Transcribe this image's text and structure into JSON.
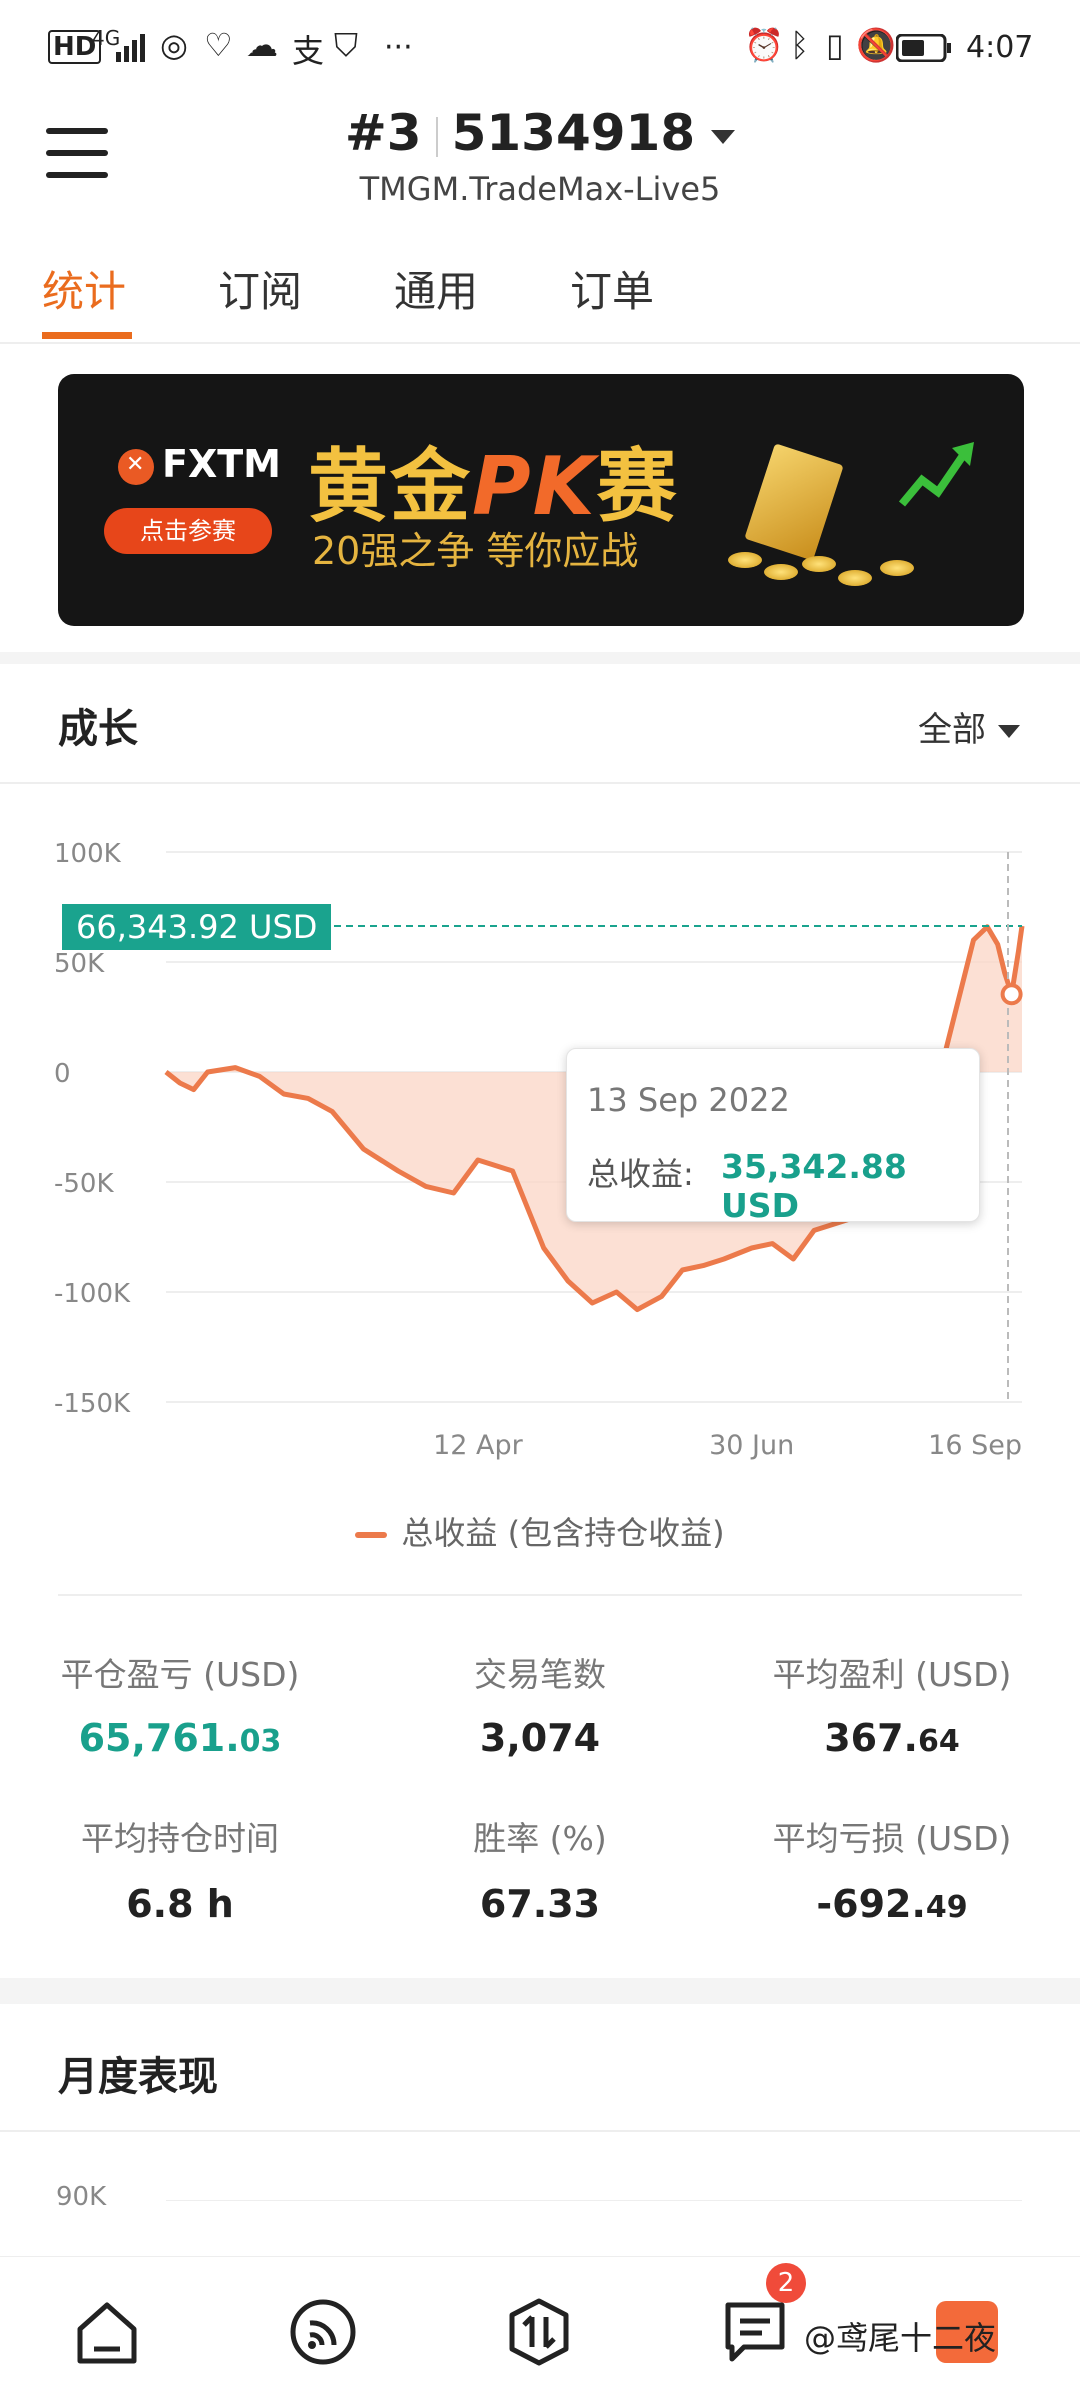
{
  "status_bar": {
    "left_icons": [
      "HD",
      "4G",
      "signal-icon",
      "app-icon",
      "heart-icon",
      "wechat-icon",
      "alipay-icon",
      "shield-icon",
      "more-icon"
    ],
    "hd": "HD",
    "network": "4G",
    "more": "···",
    "time": "4:07"
  },
  "header": {
    "account_index": "#3",
    "account_number": "5134918",
    "server": "TMGM.TradeMax-Live5"
  },
  "tabs": [
    {
      "label": "统计",
      "active": true
    },
    {
      "label": "订阅",
      "active": false
    },
    {
      "label": "通用",
      "active": false
    },
    {
      "label": "订单",
      "active": false
    }
  ],
  "banner": {
    "brand": "FXTM",
    "button": "点击参赛",
    "title_a": "黄金",
    "title_pk": "PK",
    "title_b": "赛",
    "subtitle": "20强之争  等你应战"
  },
  "growth": {
    "title": "成长",
    "filter": "全部",
    "current_value_label": "66,343.92 USD",
    "tooltip": {
      "date": "13 Sep 2022",
      "label": "总收益:",
      "value": "35,342.88 USD"
    },
    "legend": "总收益 (包含持仓收益)"
  },
  "chart_data": {
    "type": "area",
    "y_ticks": [
      "100K",
      "50K",
      "0",
      "-50K",
      "-100K",
      "-150K"
    ],
    "x_ticks": [
      "12 Apr",
      "30 Jun",
      "16 Sep"
    ],
    "ylim": [
      -150000,
      100000
    ],
    "series": [
      {
        "name": "总收益 (包含持仓收益)",
        "color": "#ec7a4b",
        "points": [
          [
            "2022-01-12",
            0
          ],
          [
            "2022-01-16",
            -5000
          ],
          [
            "2022-01-20",
            -8000
          ],
          [
            "2022-01-24",
            0
          ],
          [
            "2022-02-01",
            2000
          ],
          [
            "2022-02-08",
            -2000
          ],
          [
            "2022-02-15",
            -10000
          ],
          [
            "2022-02-22",
            -12000
          ],
          [
            "2022-03-01",
            -18000
          ],
          [
            "2022-03-10",
            -35000
          ],
          [
            "2022-03-20",
            -45000
          ],
          [
            "2022-03-28",
            -52000
          ],
          [
            "2022-04-05",
            -55000
          ],
          [
            "2022-04-12",
            -40000
          ],
          [
            "2022-04-16",
            -42000
          ],
          [
            "2022-04-22",
            -45000
          ],
          [
            "2022-05-01",
            -80000
          ],
          [
            "2022-05-08",
            -95000
          ],
          [
            "2022-05-15",
            -105000
          ],
          [
            "2022-05-22",
            -100000
          ],
          [
            "2022-05-28",
            -108000
          ],
          [
            "2022-06-04",
            -102000
          ],
          [
            "2022-06-10",
            -90000
          ],
          [
            "2022-06-16",
            -88000
          ],
          [
            "2022-06-22",
            -85000
          ],
          [
            "2022-06-30",
            -80000
          ],
          [
            "2022-07-06",
            -78000
          ],
          [
            "2022-07-12",
            -85000
          ],
          [
            "2022-07-18",
            -72000
          ],
          [
            "2022-08-01",
            -65000
          ],
          [
            "2022-08-15",
            -40000
          ],
          [
            "2022-08-25",
            10000
          ],
          [
            "2022-09-02",
            60000
          ],
          [
            "2022-09-06",
            66000
          ],
          [
            "2022-09-09",
            58000
          ],
          [
            "2022-09-11",
            45000
          ],
          [
            "2022-09-13",
            35342.88
          ],
          [
            "2022-09-15",
            55000
          ],
          [
            "2022-09-16",
            66343.92
          ]
        ]
      }
    ]
  },
  "stats": [
    {
      "label": "平仓盈亏 (USD)",
      "int": "65,761.",
      "dec": "03",
      "green": true
    },
    {
      "label": "交易笔数",
      "int": "3,074",
      "dec": "",
      "green": false
    },
    {
      "label": "平均盈利 (USD)",
      "int": "367.",
      "dec": "64",
      "green": false
    },
    {
      "label": "平均持仓时间",
      "int": "6.8 h",
      "dec": "",
      "green": false
    },
    {
      "label": "胜率 (%)",
      "int": "67.33",
      "dec": "",
      "green": false
    },
    {
      "label": "平均亏损 (USD)",
      "int": "-692.",
      "dec": "49",
      "green": false
    }
  ],
  "monthly": {
    "title": "月度表现",
    "first_tick": "90K"
  },
  "bottom_nav": {
    "items": [
      "home-icon",
      "feed-icon",
      "trade-icon",
      "messages-icon",
      "profile-icon"
    ],
    "badge": "2",
    "watermark": "@鸢尾十二夜"
  }
}
